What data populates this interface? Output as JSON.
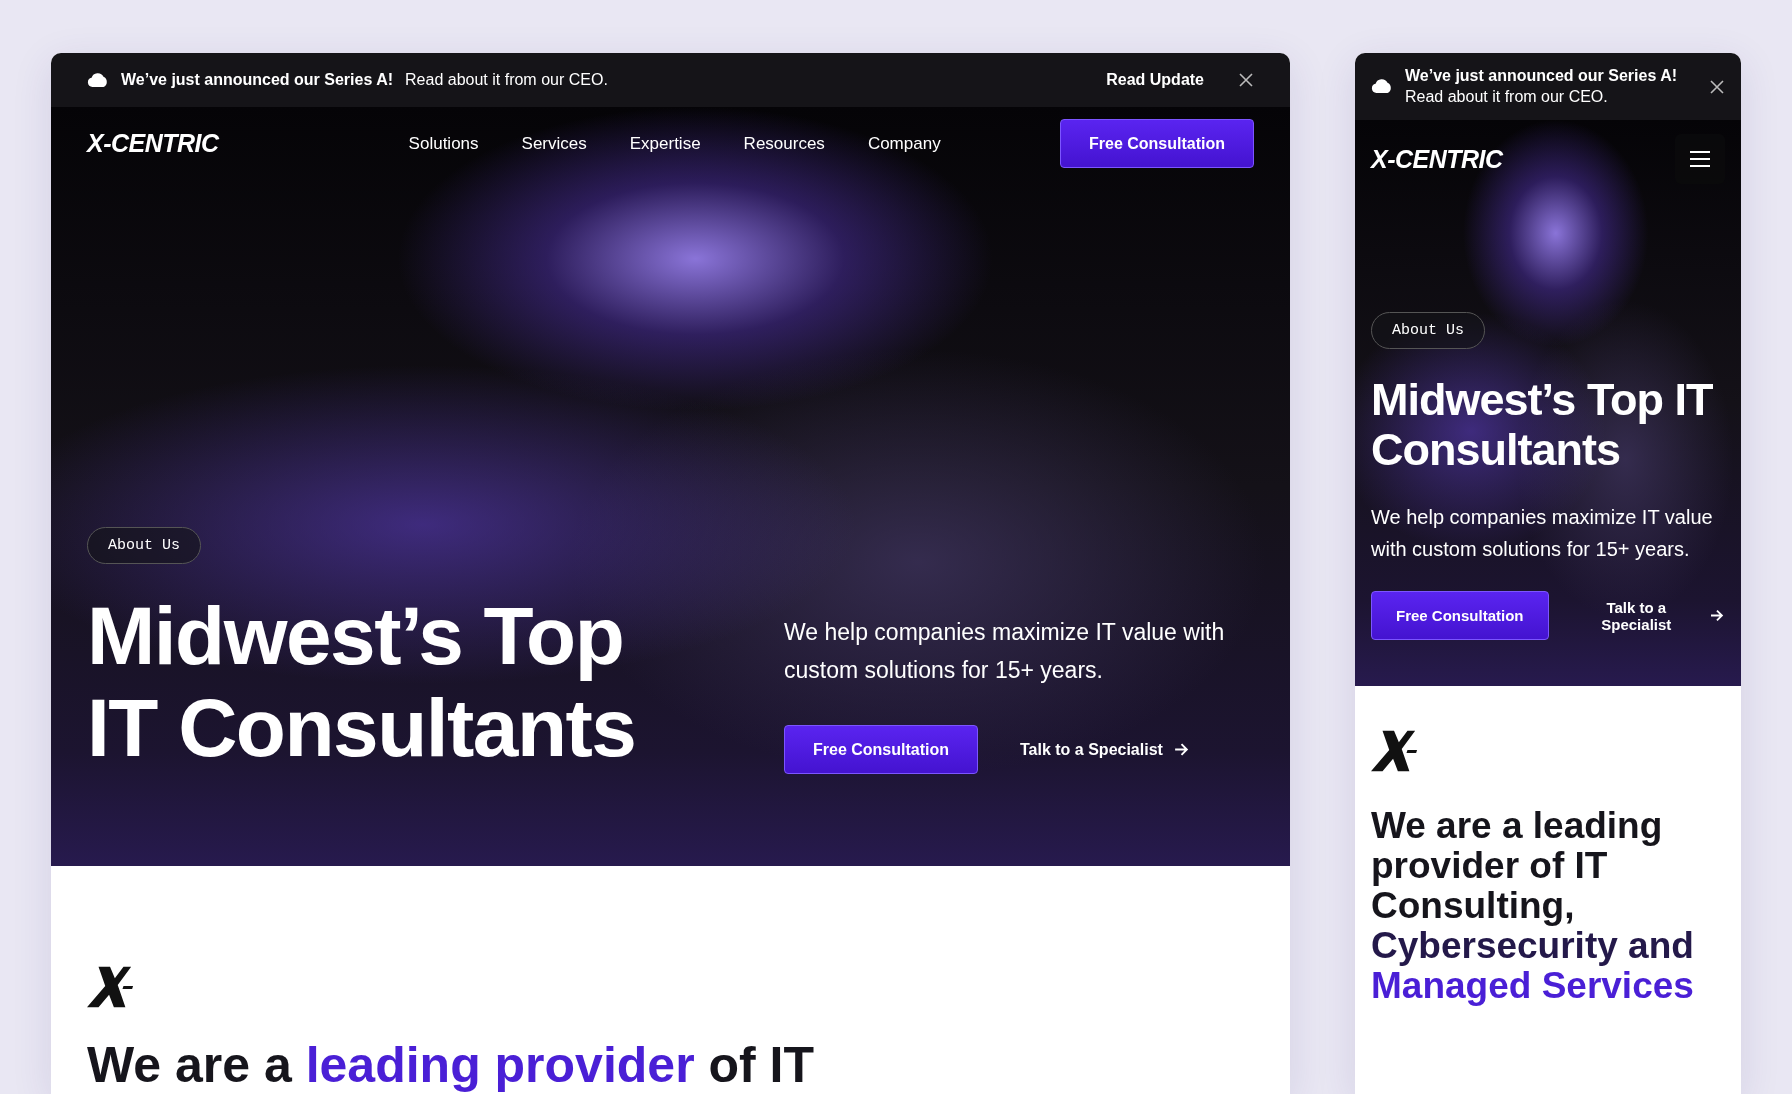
{
  "desktop_view": {
    "announcement": {
      "headline": "We’ve just announced our Series A!",
      "body": "Read about it from our CEO.",
      "link": "Read Update"
    },
    "nav": {
      "logo": "X-CENTRIC",
      "links": [
        "Solutions",
        "Services",
        "Expertise",
        "Resources",
        "Company"
      ],
      "cta": "Free Consultation"
    },
    "hero": {
      "tag": "About Us",
      "title": "Midwest’s Top IT Consultants",
      "text": "We help companies maximize IT value with custom solutions for 15+ years.",
      "primary": "Free Consultation",
      "secondary": "Talk to a Specialist"
    },
    "intro": {
      "heading": [
        {
          "text": "We are a ",
          "kind": "plain"
        },
        {
          "text": "leading provider",
          "kind": "accent"
        },
        {
          "text": " of IT",
          "kind": "plain"
        }
      ]
    }
  },
  "mobile_view": {
    "announcement": {
      "headline": "We’ve just announced our Series A!",
      "body": "Read about it from our CEO."
    },
    "nav": {
      "logo": "X-CENTRIC"
    },
    "hero": {
      "tag": "About Us",
      "title": "Midwest’s Top IT Consultants",
      "text": "We help companies maximize IT value with custom solutions for 15+ years.",
      "primary": "Free Consultation",
      "secondary": "Talk to a Specialist"
    },
    "intro": {
      "heading": [
        {
          "text": "We are a leading provider of IT Consulting, ",
          "kind": "plain"
        },
        {
          "text": "Cybersecurity and ",
          "kind": "muted"
        },
        {
          "text": "Managed Services",
          "kind": "accent"
        }
      ]
    }
  }
}
